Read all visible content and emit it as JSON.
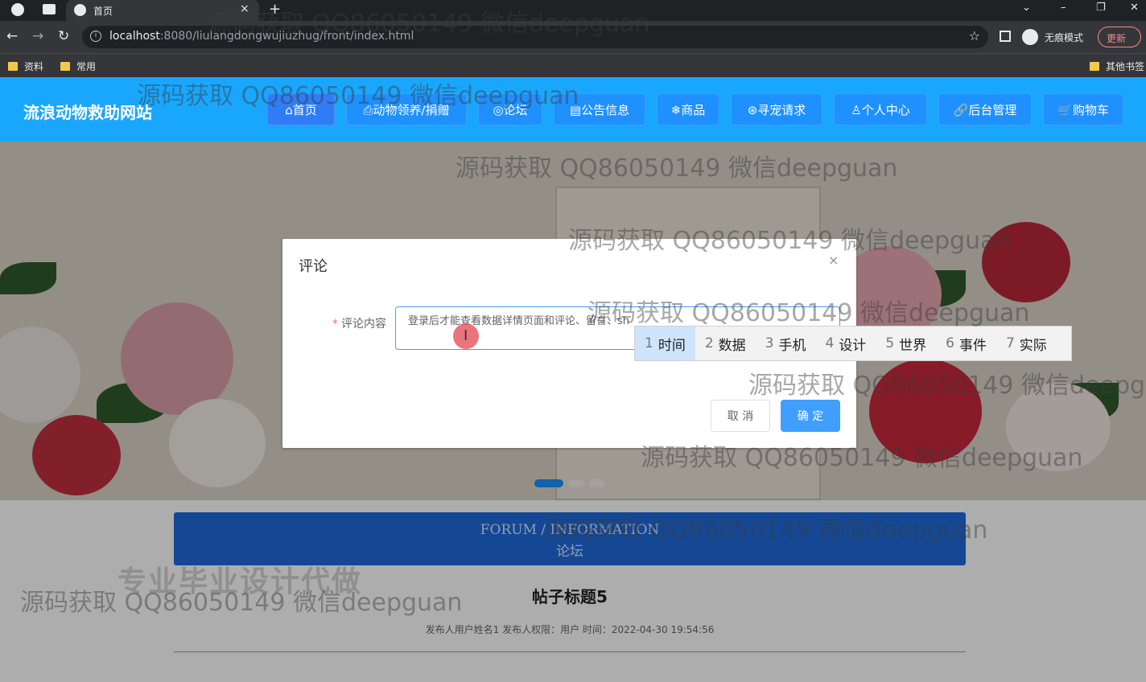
{
  "browser": {
    "tab_title": "首页",
    "url_host": "localhost",
    "url_rest": ":8080/liulangdongwujiuzhug/front/index.html",
    "incognito_label": "无痕模式",
    "update_label": "更新",
    "bookmarks": [
      "资料",
      "常用"
    ],
    "other_bookmarks": "其他书签"
  },
  "site": {
    "title": "流浪动物救助网站",
    "nav": [
      {
        "label": "⌂首页",
        "active": true
      },
      {
        "label": "⎙动物领养/捐赠"
      },
      {
        "label": "◎论坛"
      },
      {
        "label": "▤公告信息"
      },
      {
        "label": "❄商品"
      },
      {
        "label": "⊛寻宠请求"
      },
      {
        "label": "♙个人中心"
      },
      {
        "label": "🔗后台管理"
      },
      {
        "label": "🛒购物车"
      }
    ]
  },
  "forum": {
    "subtitle": "FORUM / INFORMATION",
    "title": "论坛",
    "post_title": "帖子标题5",
    "post_meta": "发布人用户姓名1   发布人权限：用户   时间：2022-04-30 19:54:56"
  },
  "promo": "专业毕业设计代做",
  "dialog": {
    "title": "评论",
    "close": "×",
    "label_required": "*",
    "label": "评论内容",
    "textarea_value": "登录后才能查看数据详情页面和评论、留言、sh",
    "cancel": "取 消",
    "confirm": "确 定"
  },
  "ime": {
    "candidates": [
      {
        "num": "1",
        "text": "时间"
      },
      {
        "num": "2",
        "text": "数据"
      },
      {
        "num": "3",
        "text": "手机"
      },
      {
        "num": "4",
        "text": "设计"
      },
      {
        "num": "5",
        "text": "世界"
      },
      {
        "num": "6",
        "text": "事件"
      },
      {
        "num": "7",
        "text": "实际"
      }
    ]
  },
  "watermark": "源码获取 QQ86050149 微信deepguan"
}
